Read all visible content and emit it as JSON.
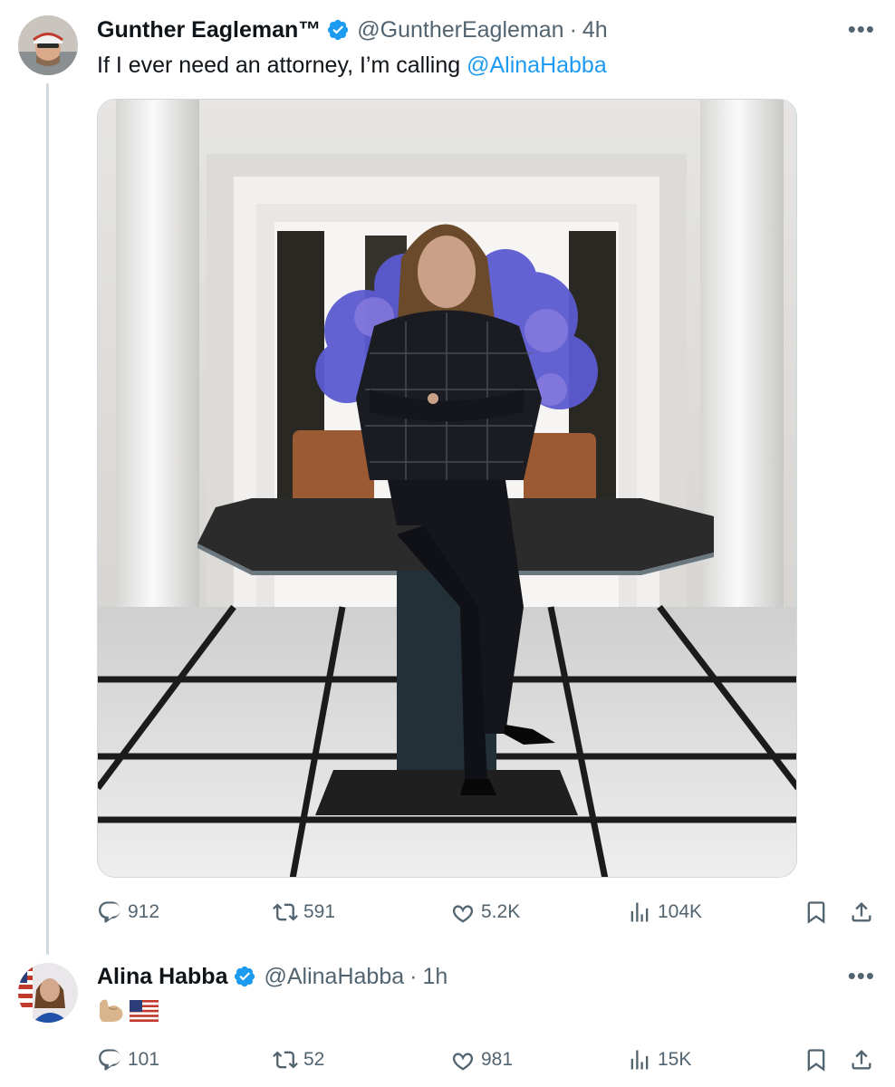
{
  "tweets": [
    {
      "author_name": "Gunther Eagleman™",
      "handle": "@GuntherEagleman",
      "separator": "·",
      "time": "4h",
      "text_prefix": "If I ever need an attorney, I’m calling ",
      "mention": "@AlinaHabba",
      "more_icon": "more-horizontal-icon",
      "stats": {
        "replies": "912",
        "retweets": "591",
        "likes": "5.2K",
        "views": "104K"
      }
    },
    {
      "author_name": "Alina Habba",
      "handle": "@AlinaHabba",
      "separator": "·",
      "time": "1h",
      "emojis": [
        "flexed-biceps",
        "us-flag"
      ],
      "stats": {
        "replies": "101",
        "retweets": "52",
        "likes": "981",
        "views": "15K"
      }
    }
  ],
  "colors": {
    "verified": "#1d9bf0",
    "link": "#1d9bf0",
    "secondary": "#536471",
    "thread_line": "#cfd9de"
  },
  "icons": [
    "reply-icon",
    "retweet-icon",
    "like-icon",
    "views-icon",
    "bookmark-icon",
    "share-icon",
    "verified-badge-icon"
  ]
}
